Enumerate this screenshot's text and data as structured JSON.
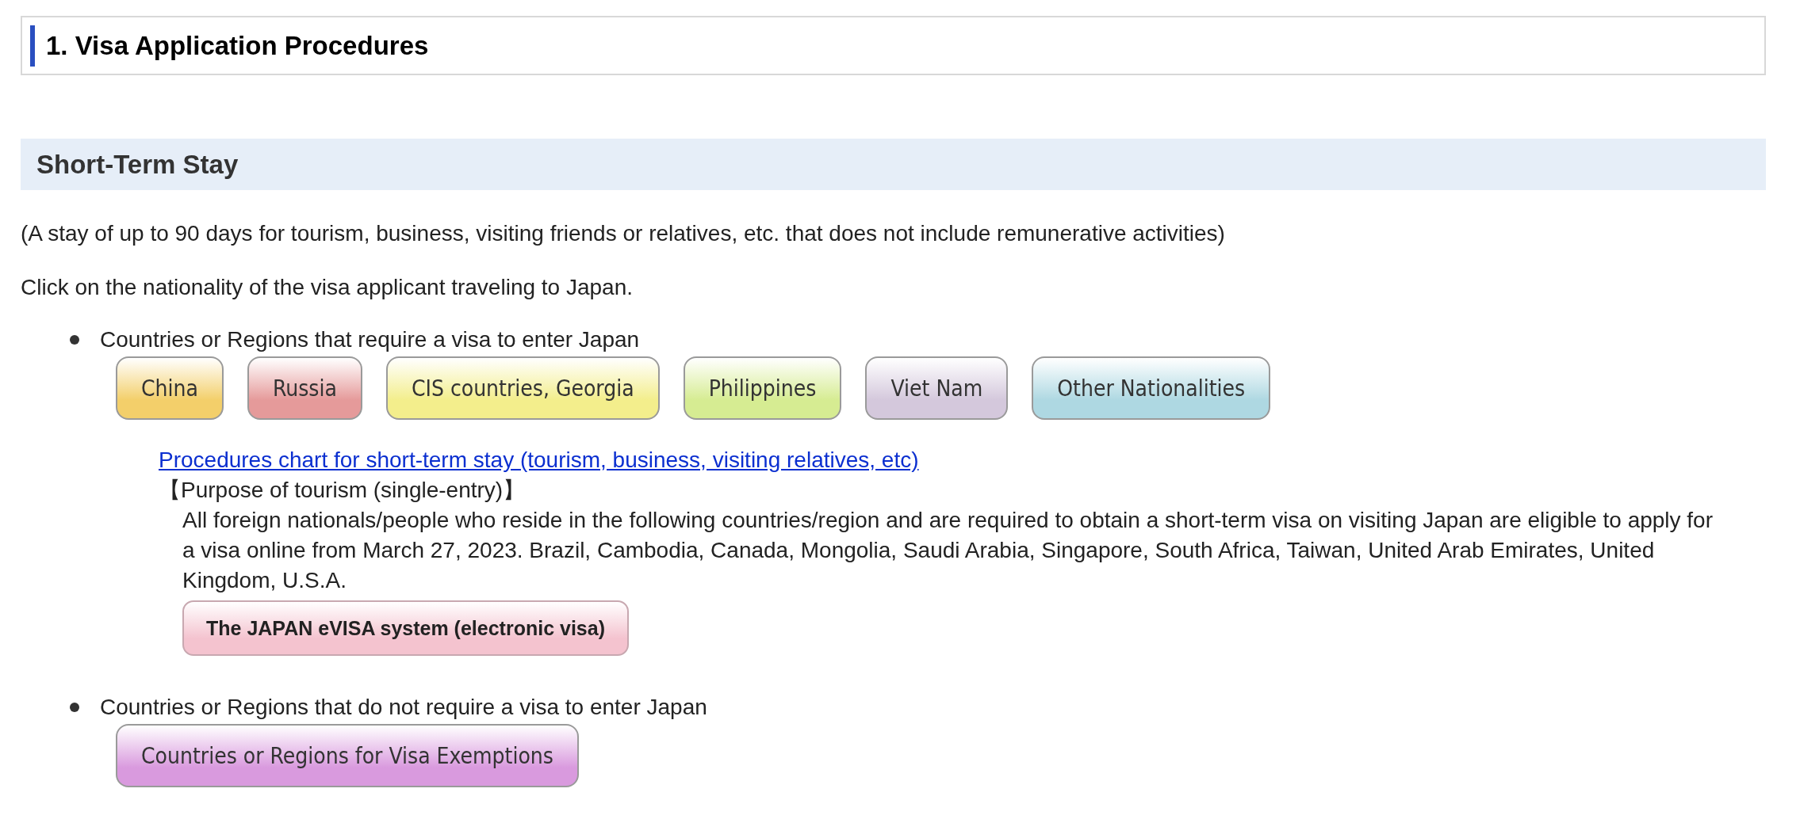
{
  "page_title": "1. Visa Application Procedures",
  "section_title": "Short-Term Stay",
  "intro": "(A stay of up to 90 days for tourism, business, visiting friends or relatives, etc. that does not include remunerative activities)",
  "instruction": "Click on the nationality of the visa applicant traveling to Japan.",
  "visa_required": {
    "label": "Countries or Regions that require a visa to enter Japan",
    "buttons": [
      {
        "label": "China",
        "color": "#f3cf6a"
      },
      {
        "label": "Russia",
        "color": "#e59a9a"
      },
      {
        "label": "CIS countries, Georgia",
        "color": "#f3ee8c"
      },
      {
        "label": "Philippines",
        "color": "#d6ec92"
      },
      {
        "label": "Viet Nam",
        "color": "#d4c8dc"
      },
      {
        "label": "Other Nationalities",
        "color": "#aed8e2"
      }
    ],
    "chart_link": "Procedures chart for short-term stay (tourism, business, visiting relatives, etc)",
    "purpose": "【Purpose of tourism (single-entry)】",
    "purpose_text": "All foreign nationals/people who reside in the following countries/region and are required to obtain a short-term visa on visiting Japan are eligible to apply for a visa online from March 27, 2023. Brazil, Cambodia, Canada, Mongolia, Saudi Arabia, Singapore, South Africa, Taiwan, United Arab Emirates, United Kingdom, U.S.A.",
    "evisa_button": {
      "label": "The JAPAN eVISA system (electronic visa)",
      "color": "#f4c3cf"
    }
  },
  "visa_exempt": {
    "label": "Countries or Regions that do not require a visa to enter Japan",
    "button": {
      "label": "Countries or Regions for Visa Exemptions",
      "color": "#d99ade"
    }
  }
}
